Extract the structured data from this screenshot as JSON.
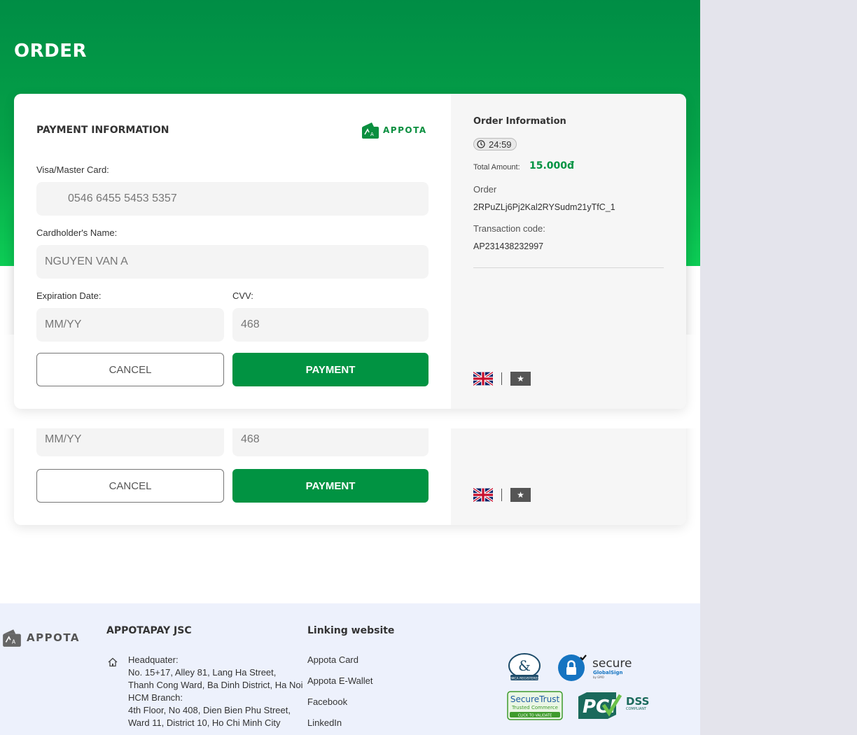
{
  "header": {
    "title": "ORDER"
  },
  "payment": {
    "title": "PAYMENT INFORMATION",
    "brand": "APPOTA",
    "card_label": "Visa/Master Card:",
    "card_value": "0546 6455 5453 5357",
    "name_label": "Cardholder's Name:",
    "name_placeholder": "NGUYEN VAN A",
    "exp_label": "Expiration Date:",
    "exp_placeholder": "MM/YY",
    "cvv_label": "CVV:",
    "cvv_value": "468",
    "cancel_label": "CANCEL",
    "pay_label": "PAYMENT"
  },
  "order": {
    "title": "Order Information",
    "timer": "24:59",
    "total_label": "Total Amount:",
    "total_value": "15.000đ",
    "order_label": "Order",
    "order_value": "2RPuZLj6Pj2Kal2RYSudm21yTfC_1",
    "tx_label": "Transaction code:",
    "tx_value": "AP231438232997",
    "lang_vn_symbol": "★"
  },
  "footer": {
    "brand": "APPOTA",
    "company": "APPOTAPAY JSC",
    "address_lines": [
      "Headquater:",
      "No. 15+17, Alley 81, Lang Ha Street, Thanh Cong Ward, Ba Dinh District, Ha Noi",
      "HCM Branch:",
      "4th Floor, No 408, Dien Bien Phu Street, Ward 11, District 10, Ho Chi Minh City"
    ],
    "linking_title": "Linking website",
    "links": [
      "Appota Card",
      "Appota E-Wallet",
      "Facebook",
      "LinkedIn"
    ],
    "badges": {
      "dmca": "DMCA REGISTERED",
      "secure": "secure",
      "globalsign": "GlobalSign",
      "bygmo": "by GMO",
      "securetrust": "SecureTrust",
      "trusted": "Trusted Commerce",
      "validate": "CLICK TO VALIDATE",
      "pci": "PCI",
      "dss": "DSS",
      "compliant": "COMPLIANT"
    }
  },
  "colors": {
    "primary": "#019342",
    "hero_top": "#008d45",
    "hero_bottom": "#0dcc55",
    "footer_bg": "#edf1fc"
  }
}
